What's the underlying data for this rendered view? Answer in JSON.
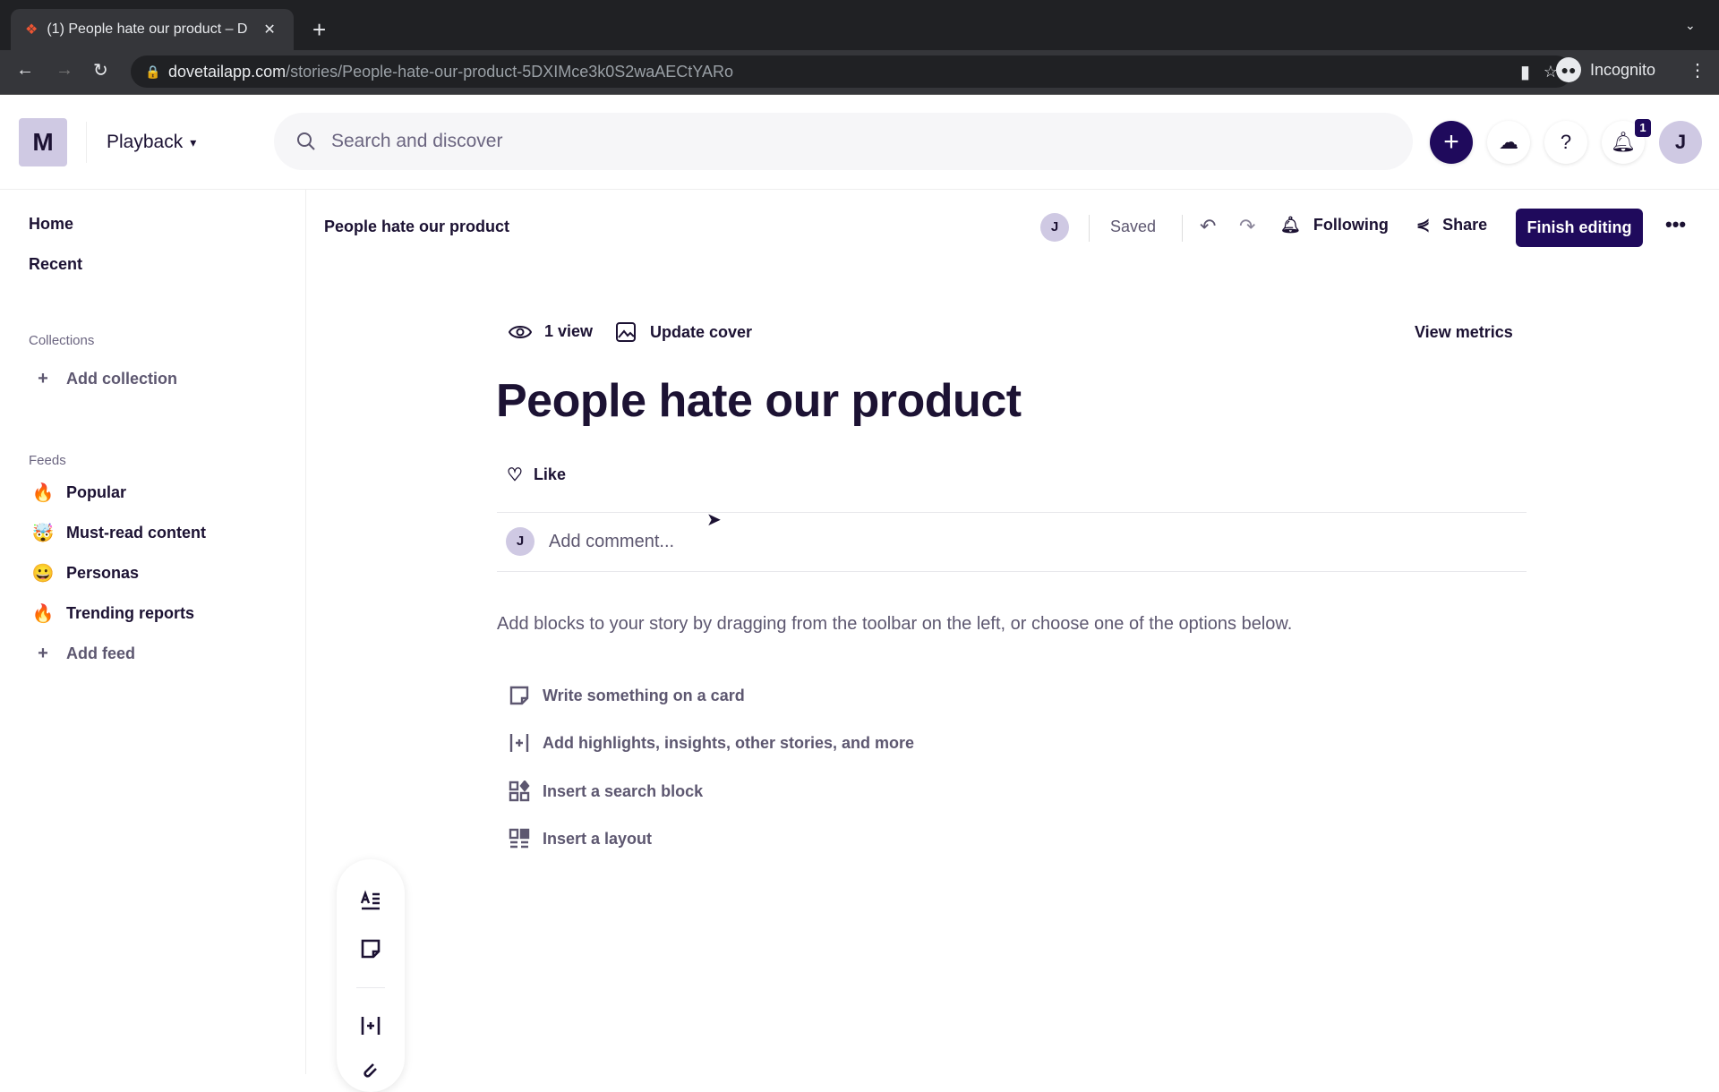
{
  "browser": {
    "tab_title": "(1) People hate our product – D",
    "url_domain": "dovetailapp.com",
    "url_path": "/stories/People-hate-our-product-5DXIMce3k0S2waAECtYARo",
    "profile": "Incognito"
  },
  "header": {
    "workspace_initial": "M",
    "project": "Playback",
    "search_placeholder": "Search and discover",
    "notification_count": "1",
    "user_initial": "J"
  },
  "sidebar": {
    "nav": [
      {
        "label": "Home"
      },
      {
        "label": "Recent"
      }
    ],
    "collections_title": "Collections",
    "add_collection": "Add collection",
    "feeds_title": "Feeds",
    "feeds": [
      {
        "emoji": "🔥",
        "icon": "popular-icon",
        "label": "Popular"
      },
      {
        "emoji": "🤯",
        "icon": "exploding-head-icon",
        "label": "Must-read content"
      },
      {
        "emoji": "😀",
        "icon": "grinning-face-icon",
        "label": "Personas"
      },
      {
        "emoji": "🔥",
        "icon": "fire-icon",
        "label": "Trending reports"
      }
    ],
    "add_feed": "Add feed"
  },
  "story": {
    "breadcrumb_title": "People hate our product",
    "editor_initial": "J",
    "status": "Saved",
    "following": "Following",
    "share": "Share",
    "finish_editing": "Finish editing",
    "views": "1 view",
    "update_cover": "Update cover",
    "view_metrics": "View metrics",
    "title": "People hate our product",
    "like": "Like",
    "comment_initial": "J",
    "comment_placeholder": "Add comment...",
    "helper": "Add blocks to your story by dragging from the toolbar on the left, or choose one of the options below.",
    "options": [
      {
        "label": "Write something on a card"
      },
      {
        "label": "Add highlights, insights, other stories, and more"
      },
      {
        "label": "Insert a search block"
      },
      {
        "label": "Insert a layout"
      }
    ]
  },
  "colors": {
    "brand": "#1f0a5c",
    "avatar": "#cfc9e3"
  }
}
